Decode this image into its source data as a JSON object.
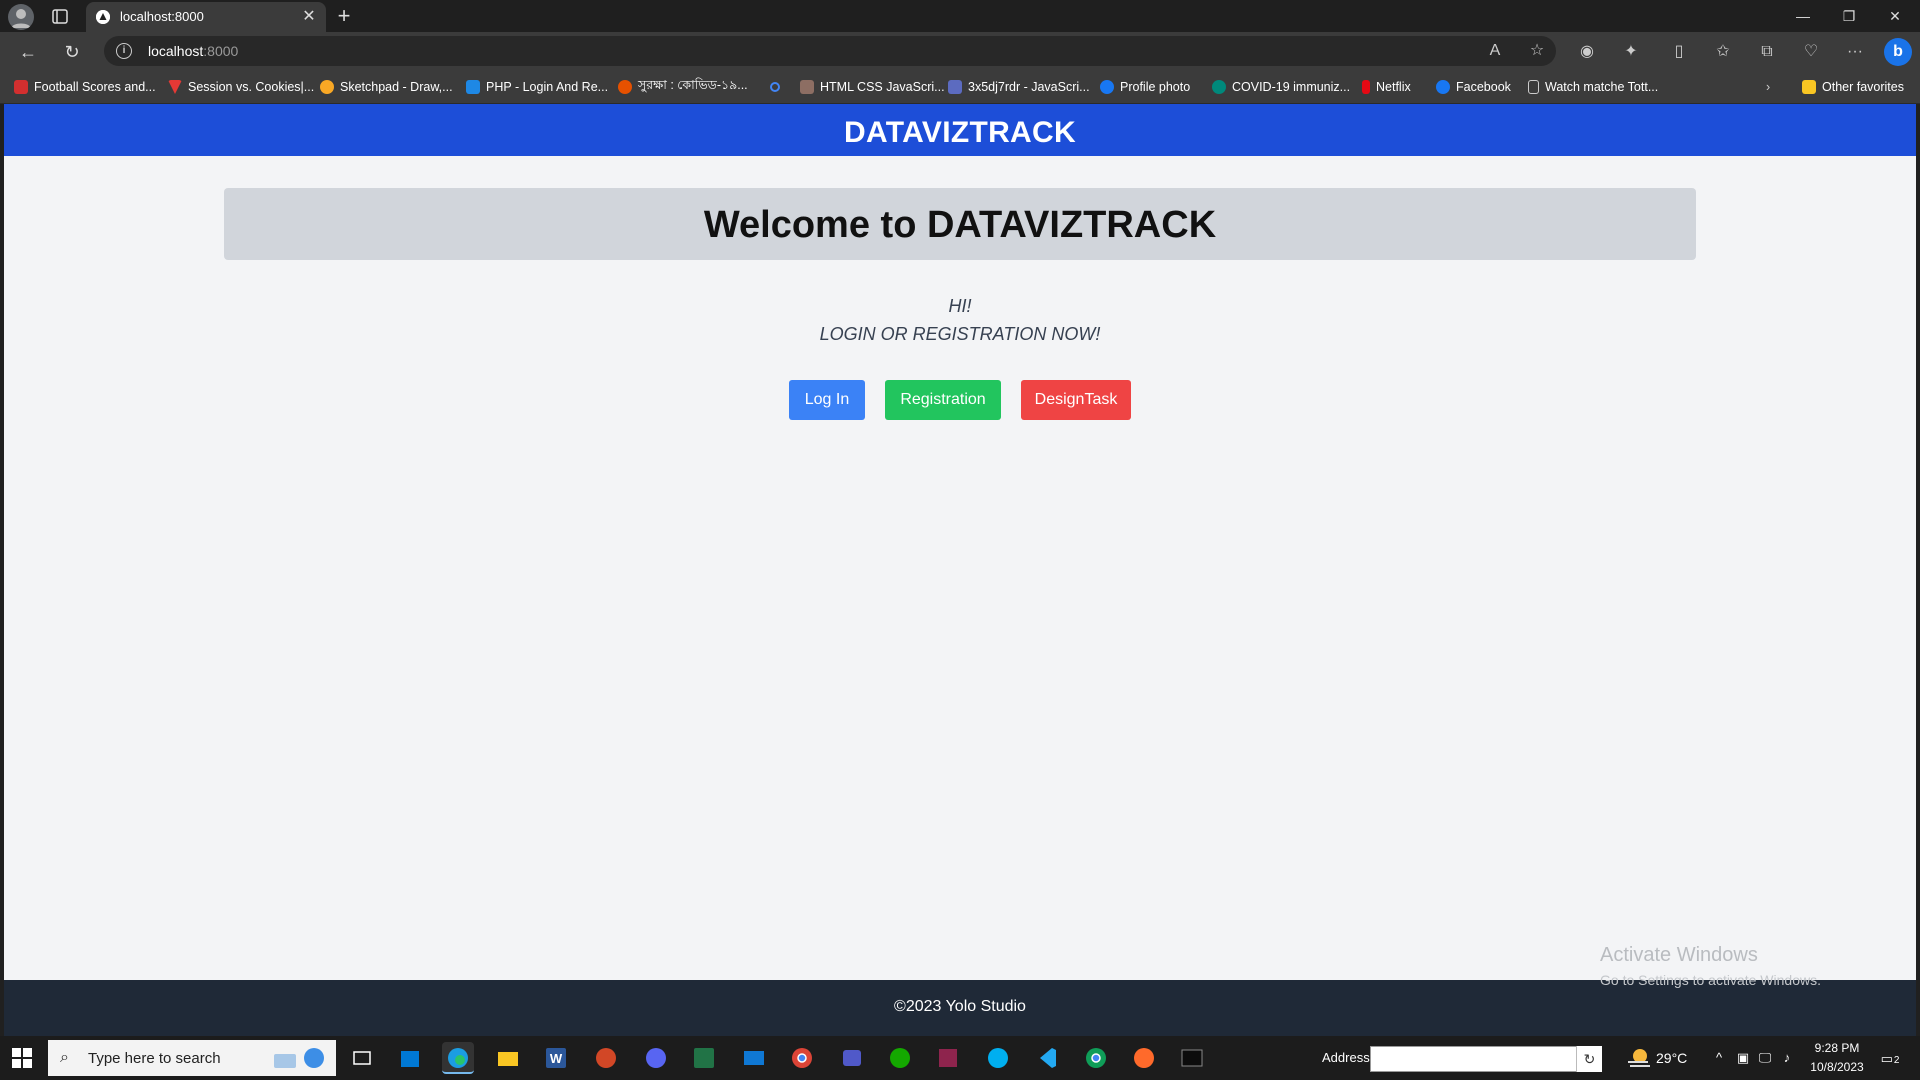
{
  "browser": {
    "tab_title": "localhost:8000",
    "url_host": "localhost",
    "url_port": ":8000",
    "bookmarks": [
      {
        "label": "Football Scores and...",
        "icon": "red-square-icon",
        "color": "#d32f2f"
      },
      {
        "label": "Session vs. Cookies|...",
        "icon": "red-triangle-icon",
        "color": "#e53935"
      },
      {
        "label": "Sketchpad - Draw,...",
        "icon": "sketchpad-icon",
        "color": "#f9a825"
      },
      {
        "label": "PHP - Login And Re...",
        "icon": "php-icon",
        "color": "#1e88e5"
      },
      {
        "label": "সুরক্ষা : কোভিড-১৯...",
        "icon": "gov-seal-icon",
        "color": "#e65100"
      },
      {
        "label": "",
        "icon": "search-icon",
        "color": "#4285f4"
      },
      {
        "label": "HTML CSS JavaScri...",
        "icon": "html-book-icon",
        "color": "#8d6e63"
      },
      {
        "label": "3x5dj7rdr - JavaScri...",
        "icon": "code-icon",
        "color": "#5c6bc0"
      },
      {
        "label": "Profile photo",
        "icon": "facebook-icon",
        "color": "#1877f2"
      },
      {
        "label": "COVID-19 immuniz...",
        "icon": "virus-icon",
        "color": "#00897b"
      },
      {
        "label": "Netflix",
        "icon": "netflix-icon",
        "color": "#e50914"
      },
      {
        "label": "Facebook",
        "icon": "facebook-icon",
        "color": "#1877f2"
      },
      {
        "label": "Watch matche Tott...",
        "icon": "page-icon",
        "color": "#9e9e9e"
      }
    ],
    "other_favorites": "Other favorites"
  },
  "site": {
    "brand": "DATAVIZTRACK",
    "hero_title": "Welcome to DATAVIZTRACK",
    "greeting_line1": "HI!",
    "greeting_line2": "LOGIN OR REGISTRATION NOW!",
    "buttons": {
      "login": "Log In",
      "registration": "Registration",
      "design_task": "DesignTask"
    },
    "footer": "©2023 Yolo Studio",
    "colors": {
      "header": "#1d4ed8",
      "login": "#3b82f6",
      "registration": "#22c55e",
      "design_task": "#ef4444",
      "footer": "#1f2937"
    }
  },
  "watermark": {
    "title": "Activate Windows",
    "subtitle": "Go to Settings to activate Windows."
  },
  "taskbar": {
    "search_placeholder": "Type here to search",
    "address_label": "Address",
    "address_value": "",
    "weather": "29°C",
    "time": "9:28 PM",
    "date": "10/8/2023",
    "notifications": "2",
    "apps": [
      "task-view-icon",
      "store-icon",
      "edge-icon",
      "file-explorer-icon",
      "word-icon",
      "powerpoint-icon",
      "discord-icon",
      "excel-icon",
      "mail-icon",
      "chrome-icon",
      "teams-icon",
      "upwork-icon",
      "winrar-icon",
      "skype-icon",
      "vscode-icon",
      "chrome-icon",
      "sublime-icon",
      "terminal-icon"
    ]
  }
}
